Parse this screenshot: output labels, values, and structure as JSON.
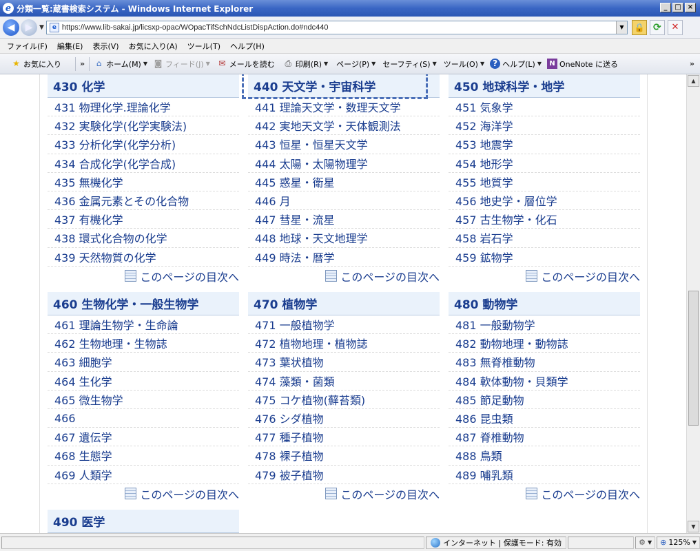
{
  "window": {
    "title": "分類一覧:蔵書検索システム - Windows Internet Explorer",
    "controls": {
      "minimize": "_",
      "maximize": "□",
      "close": "×"
    }
  },
  "address": {
    "url": "https://www.lib-sakai.jp/licsxp-opac/WOpacTifSchNdcListDispAction.do#ndc440"
  },
  "menu": [
    "ファイル(F)",
    "編集(E)",
    "表示(V)",
    "お気に入り(A)",
    "ツール(T)",
    "ヘルプ(H)"
  ],
  "command_bar": {
    "favorites": "お気に入り",
    "home": "ホーム(M)",
    "feeds": "フィード(J)",
    "mail": "メールを読む",
    "print": "印刷(R)",
    "page": "ページ(P)",
    "safety": "セーフティ(S)",
    "tools": "ツール(O)",
    "help": "ヘルプ(L)",
    "onenote": "OneNote に送る"
  },
  "toc_label": "このページの目次へ",
  "categories": [
    {
      "title": "430 化学",
      "items": [
        "431 物理化学.理論化学",
        "432 実験化学(化学実験法)",
        "433 分析化学(化学分析)",
        "434 合成化学(化学合成)",
        "435 無機化学",
        "436 金属元素とその化合物",
        "437 有機化学",
        "438 環式化合物の化学",
        "439 天然物質の化学"
      ]
    },
    {
      "title": "440 天文学・宇宙科学",
      "items": [
        "441 理論天文学・数理天文学",
        "442 実地天文学・天体観測法",
        "443 恒星・恒星天文学",
        "444 太陽・太陽物理学",
        "445 惑星・衛星",
        "446 月",
        "447 彗星・流星",
        "448 地球・天文地理学",
        "449 時法・暦学"
      ]
    },
    {
      "title": "450 地球科学・地学",
      "items": [
        "451 気象学",
        "452 海洋学",
        "453 地震学",
        "454 地形学",
        "455 地質学",
        "456 地史学・層位学",
        "457 古生物学・化石",
        "458 岩石学",
        "459 鉱物学"
      ]
    },
    {
      "title": "460 生物化学・一般生物学",
      "items": [
        "461 理論生物学・生命論",
        "462 生物地理・生物誌",
        "463 細胞学",
        "464 生化学",
        "465 微生物学",
        "466",
        "467 遺伝学",
        "468 生態学",
        "469 人類学"
      ]
    },
    {
      "title": "470 植物学",
      "items": [
        "471 一般植物学",
        "472 植物地理・植物誌",
        "473 葉状植物",
        "474 藻類・菌類",
        "475 コケ植物(蘚苔類)",
        "476 シダ植物",
        "477 種子植物",
        "478 裸子植物",
        "479 被子植物"
      ]
    },
    {
      "title": "480 動物学",
      "items": [
        "481 一般動物学",
        "482 動物地理・動物誌",
        "483 無脊椎動物",
        "484 軟体動物・貝類学",
        "485 節足動物",
        "486 昆虫類",
        "487 脊椎動物",
        "488 鳥類",
        "489 哺乳類"
      ]
    },
    {
      "title": "490 医学",
      "items": []
    }
  ],
  "status": {
    "zone": "インターネット | 保護モード: 有効",
    "zoom": "125%"
  }
}
